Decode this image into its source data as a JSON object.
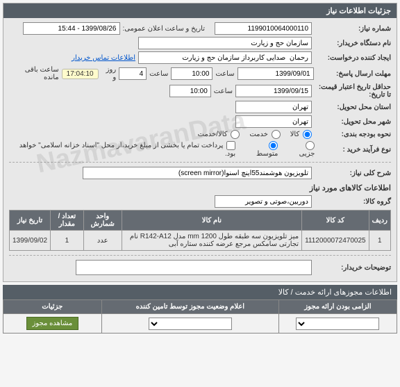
{
  "header": {
    "title": "جزئیات اطلاعات نیاز"
  },
  "fields": {
    "req_number_label": "شماره نیاز:",
    "req_number": "1199010064000110",
    "announce_label": "تاریخ و ساعت اعلان عمومی:",
    "announce_value": "1399/08/26 - 15:44",
    "buyer_org_label": "نام دستگاه خریدار:",
    "buyer_org": "سازمان حج و زیارت",
    "creator_label": "ایجاد کننده درخواست:",
    "creator": "رحمان  صدایی کاربرداز سازمان حج و زیارت",
    "contact_link": "اطلاعات تماس خریدار",
    "deadline_send_label": "مهلت ارسال پاسخ:",
    "until_label": "تا تاریخ:",
    "date1": "1399/09/01",
    "time_word": "ساعت",
    "time1": "10:00",
    "days_left": "4",
    "day_word": "روز و",
    "countdown": "17:04:10",
    "remain_text": "ساعت باقی مانده",
    "min_credit_label": "حداقل تاریخ اعتبار قیمت: تا تاریخ:",
    "date2": "1399/09/15",
    "time2": "10:00",
    "delivery_province_label": "استان محل تحویل:",
    "delivery_province": "تهران",
    "delivery_city_label": "شهر محل تحویل:",
    "delivery_city": "تهران",
    "budget_label": "نحوه بودجه بندی:",
    "budget_opts": {
      "goods": "کالا",
      "service": "خدمت",
      "goods_service": "کالا/خدمت"
    },
    "purchase_type_label": "نوع فرآیند خرید :",
    "purchase_opts": {
      "small": "جزیی",
      "medium": "متوسط"
    },
    "payment_note": "پرداخت تمام یا بخشی از مبلغ خرید،از محل \"اسناد خزانه اسلامی\" خواهد بود.",
    "general_desc_label": "شرح کلی نیاز:",
    "general_desc": "تلویزیون هوشمند55اینچ اسنوا(screen mirror)",
    "items_header": "اطلاعات کالاهای مورد نیاز",
    "group_label": "گروه کالا:",
    "group_value": "دوربین،صوتی و تصویر",
    "buyer_notes_label": "توضیحات خریدار:",
    "buyer_notes": ""
  },
  "table": {
    "headers": {
      "row": "ردیف",
      "code": "کد کالا",
      "name": "نام کالا",
      "unit": "واحد شمارش",
      "qty": "تعداد / مقدار",
      "date": "تاریخ نیاز"
    },
    "rows": [
      {
        "row": "1",
        "code": "1112000072470025",
        "name": "میز تلویزیون سه طبقه طول 1200 mm مدل R142-A12 نام تجارتی سامکس مرجع عرضه کننده ستاره آبی",
        "unit": "عدد",
        "qty": "1",
        "date": "1399/09/02"
      }
    ]
  },
  "auth": {
    "section_title": "اطلاعات مجوزهای ارائه خدمت / کالا",
    "headers": {
      "required": "الزامی بودن ارائه مجوز",
      "status": "اعلام وضعیت مجوز توسط تامین کننده",
      "details": "جزئیات"
    },
    "row": {
      "required_value": "",
      "status_value": "",
      "btn": "مشاهده مجوز"
    }
  },
  "watermark": "NazmavaranData"
}
